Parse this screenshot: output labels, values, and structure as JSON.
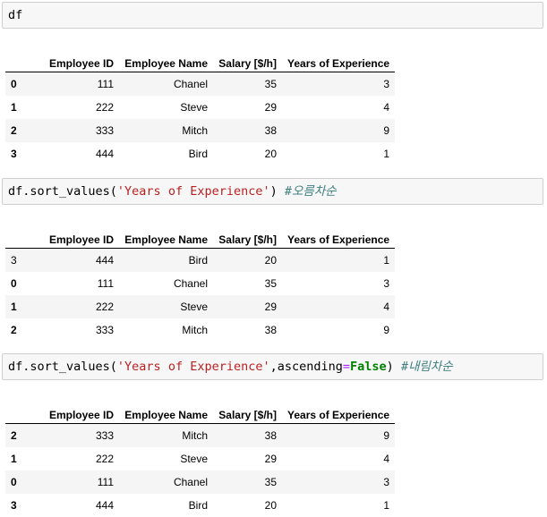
{
  "cells": [
    {
      "code": "df",
      "table": {
        "columns": [
          "Employee ID",
          "Employee Name",
          "Salary [$/h]",
          "Years of Experience"
        ],
        "index_bold": true,
        "rows": [
          {
            "index": "0",
            "values": [
              "111",
              "Chanel",
              "35",
              "3"
            ]
          },
          {
            "index": "1",
            "values": [
              "222",
              "Steve",
              "29",
              "4"
            ]
          },
          {
            "index": "2",
            "values": [
              "333",
              "Mitch",
              "38",
              "9"
            ]
          },
          {
            "index": "3",
            "values": [
              "444",
              "Bird",
              "20",
              "1"
            ]
          }
        ]
      }
    },
    {
      "code_parts": {
        "pre": "df.sort_values(",
        "str": "'Years of Experience'",
        "post": ") ",
        "comment": "#오름차순"
      },
      "table": {
        "columns": [
          "Employee ID",
          "Employee Name",
          "Salary [$/h]",
          "Years of Experience"
        ],
        "rows": [
          {
            "index": "3",
            "values": [
              "444",
              "Bird",
              "20",
              "1"
            ]
          },
          {
            "index": "0",
            "values": [
              "111",
              "Chanel",
              "35",
              "3"
            ]
          },
          {
            "index": "1",
            "values": [
              "222",
              "Steve",
              "29",
              "4"
            ]
          },
          {
            "index": "2",
            "values": [
              "333",
              "Mitch",
              "38",
              "9"
            ]
          }
        ]
      }
    },
    {
      "code_parts": {
        "pre": "df.sort_values(",
        "str": "'Years of Experience'",
        "mid": ",ascending",
        "op": "=",
        "kw": "False",
        "post": ") ",
        "comment": "#내림차순"
      },
      "table": {
        "columns": [
          "Employee ID",
          "Employee Name",
          "Salary [$/h]",
          "Years of Experience"
        ],
        "rows": [
          {
            "index": "2",
            "values": [
              "333",
              "Mitch",
              "38",
              "9"
            ]
          },
          {
            "index": "1",
            "values": [
              "222",
              "Steve",
              "29",
              "4"
            ]
          },
          {
            "index": "0",
            "values": [
              "111",
              "Chanel",
              "35",
              "3"
            ]
          },
          {
            "index": "3",
            "values": [
              "444",
              "Bird",
              "20",
              "1"
            ]
          }
        ]
      }
    }
  ]
}
